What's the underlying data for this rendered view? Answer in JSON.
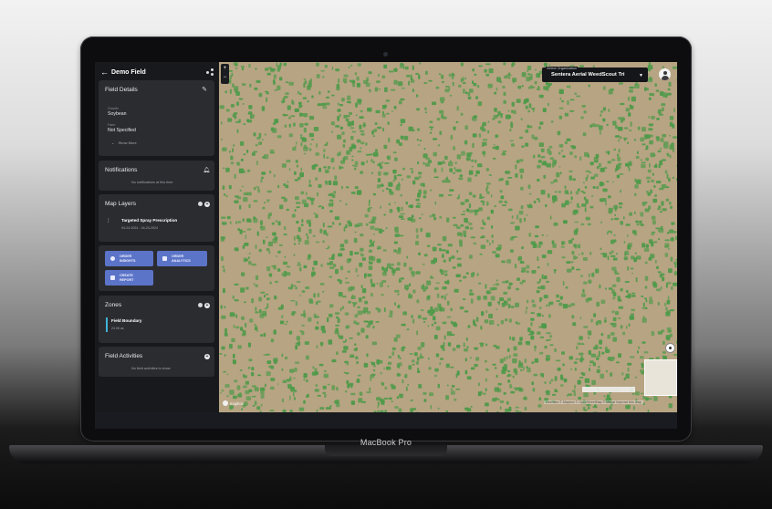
{
  "device": {
    "brand": "MacBook Pro"
  },
  "sidebar": {
    "title": "Demo Field",
    "field_details": {
      "title": "Field Details",
      "crop_label": "Growth",
      "crop_value": "Soybean",
      "farm_label": "Farm",
      "farm_value": "Not Specified",
      "more_link": "Show More"
    },
    "notifications": {
      "title": "Notifications",
      "empty_text": "No notifications at this time"
    },
    "map_layers": {
      "title": "Map Layers",
      "item_title": "Targeted Spray Prescription",
      "item_date": "04-24-2024 - 04-24-2024"
    },
    "actions": {
      "order_insights": "ORDER INSIGHTS",
      "order_analytics": "ORDER ANALYTICS",
      "create_report": "CREATE REPORT"
    },
    "zones": {
      "title": "Zones",
      "item_title": "Field Boundary",
      "item_sub": "24.06 ac"
    },
    "field_activities": {
      "title": "Field Activities",
      "empty_text": "No field activities to show"
    }
  },
  "map": {
    "org_label": "Select Organization",
    "org_value": "Sentera Aerial WeedScout Tri",
    "attribution": "Licenses © Mapbox © OpenStreetMap © Maxar Improve this map",
    "mapbox": "mapbox",
    "colors": {
      "soil": "#b7a483",
      "weed": "#4f9a4a"
    }
  },
  "icons": [
    "back-arrow-icon",
    "share-icon",
    "pencil-icon",
    "bell-icon",
    "layers-icon",
    "plus-icon",
    "chevron-down-icon",
    "user-avatar-icon",
    "locate-icon"
  ]
}
